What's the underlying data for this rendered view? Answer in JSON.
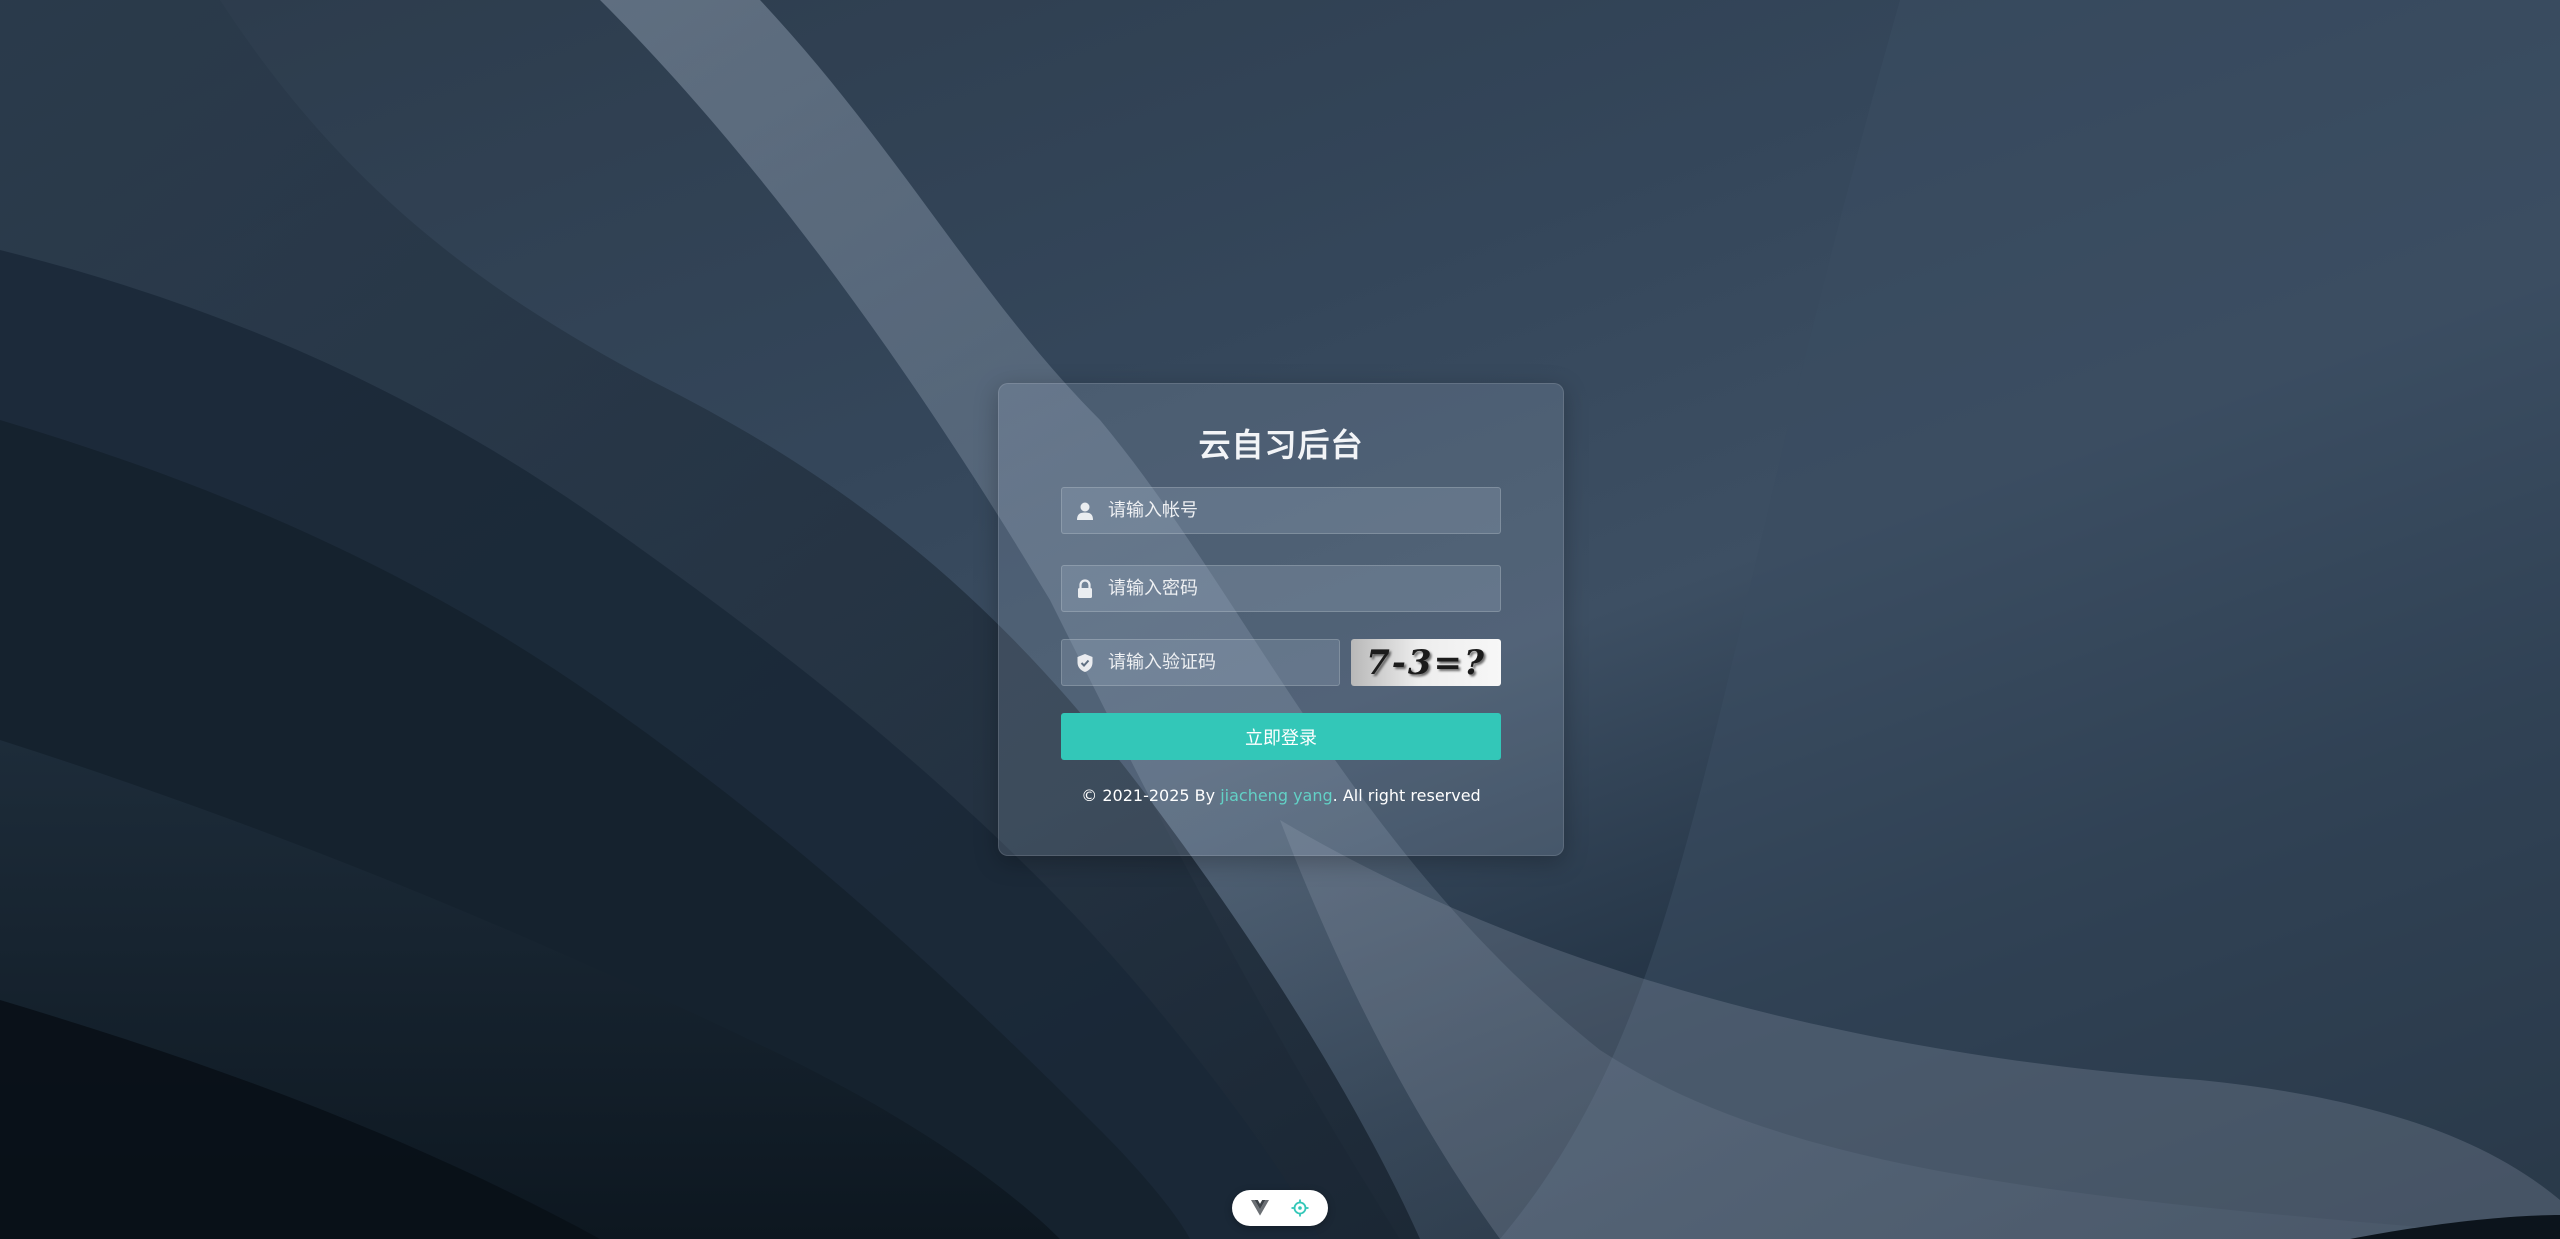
{
  "login": {
    "title": "云自习后台",
    "account_placeholder": "请输入帐号",
    "password_placeholder": "请输入密码",
    "captcha_placeholder": "请输入验证码",
    "captcha_text": "7-3=?",
    "submit_label": "立即登录"
  },
  "footer": {
    "prefix": "© 2021-2025 By ",
    "author": "jiacheng yang",
    "suffix": ". All right reserved"
  },
  "icons": {
    "account": "user-icon",
    "password": "lock-icon",
    "captcha": "shield-check-icon",
    "devtools_vue": "vue-logo-icon",
    "devtools_inspect": "crosshair-target-icon"
  },
  "colors": {
    "accent": "#33c7b8",
    "link": "#62d1c6"
  }
}
